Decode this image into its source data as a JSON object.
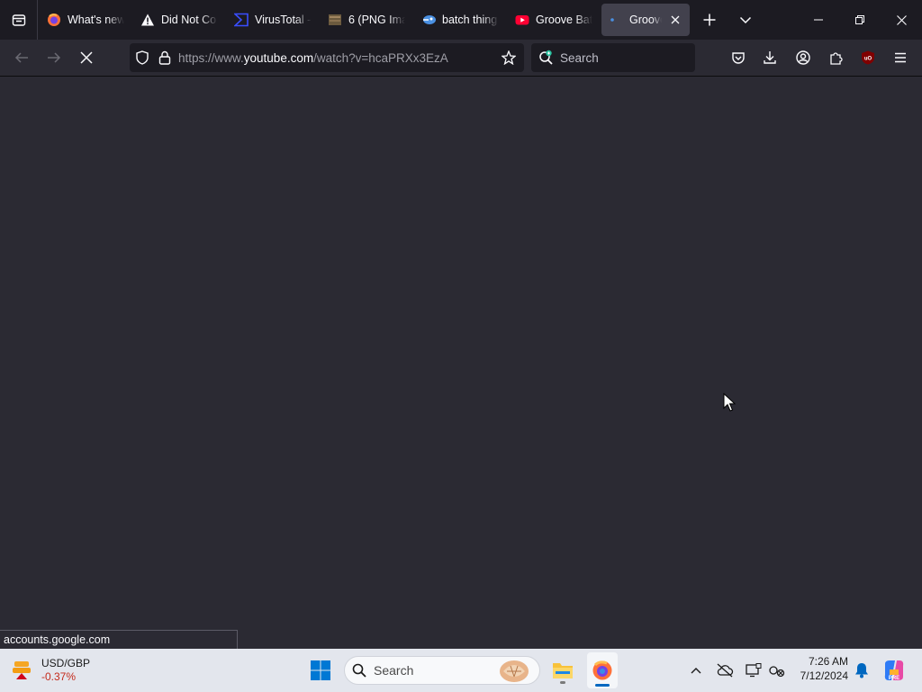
{
  "tabs": [
    {
      "label": "What's new",
      "icon": "firefox-icon"
    },
    {
      "label": "Did Not Co",
      "icon": "warning-icon"
    },
    {
      "label": "VirusTotal -",
      "icon": "virustotal-icon"
    },
    {
      "label": "6 (PNG Ima",
      "icon": "image-icon"
    },
    {
      "label": "batch thing",
      "icon": "translate-icon"
    },
    {
      "label": "Groove Bat",
      "icon": "youtube-icon"
    },
    {
      "label": "Groove",
      "icon": "loading-icon",
      "active": true
    }
  ],
  "navbar": {
    "url_prefix": "https://www.",
    "url_host": "youtube.com",
    "url_path": "/watch?v=hcaPRXx3EzA",
    "search_placeholder": "Search"
  },
  "status_text": "accounts.google.com",
  "taskbar": {
    "widget_title": "USD/GBP",
    "widget_change": "-0.37%",
    "search_placeholder": "Search",
    "time": "7:26 AM",
    "date": "7/12/2024"
  },
  "colors": {
    "accent": "#0067c0",
    "content_bg": "#2b2a33",
    "tabstrip_bg": "#1c1b22"
  }
}
